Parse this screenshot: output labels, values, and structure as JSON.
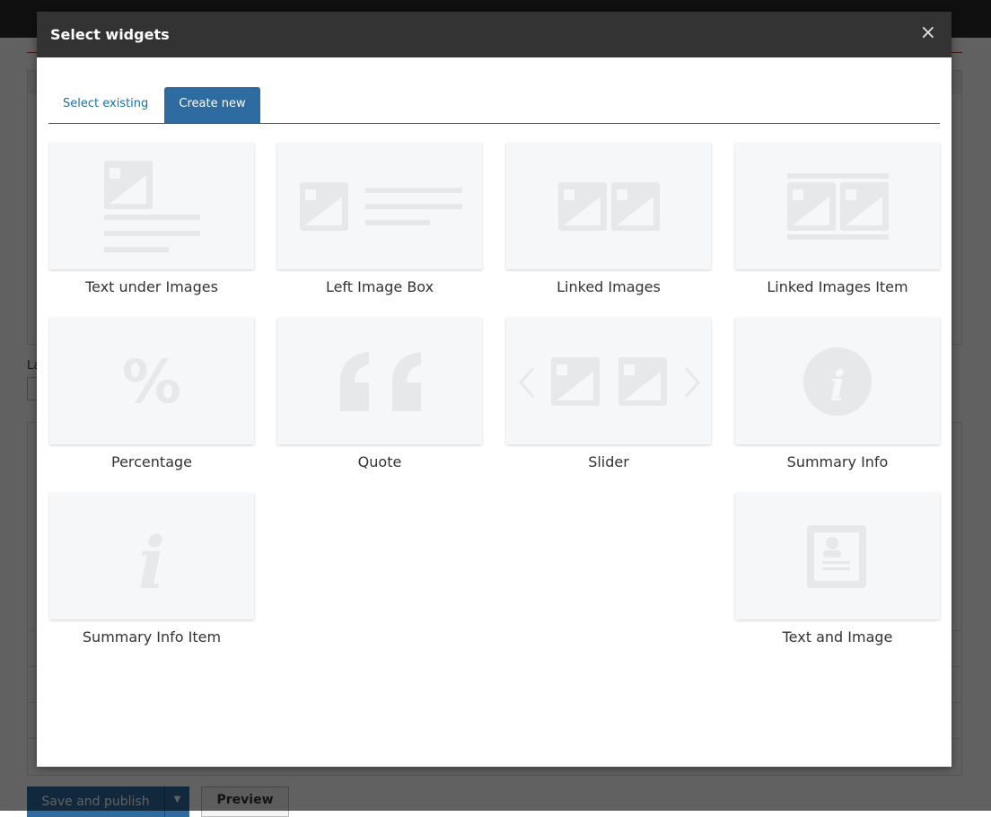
{
  "modal": {
    "title": "Select widgets",
    "close_glyph": "×"
  },
  "tabs": [
    {
      "label": "Select existing",
      "active": false
    },
    {
      "label": "Create new",
      "active": true
    }
  ],
  "widgets": [
    {
      "label": "Text under Images",
      "icon": "text-under-images-icon"
    },
    {
      "label": "Left Image Box",
      "icon": "left-image-box-icon"
    },
    {
      "label": "Linked Images",
      "icon": "linked-images-icon"
    },
    {
      "label": "Linked Images Item",
      "icon": "linked-images-item-icon"
    },
    {
      "label": "Percentage",
      "icon": "percentage-icon"
    },
    {
      "label": "Quote",
      "icon": "quote-icon"
    },
    {
      "label": "Slider",
      "icon": "slider-icon"
    },
    {
      "label": "Summary Info",
      "icon": "summary-info-icon"
    },
    {
      "label": "Summary Info Item",
      "icon": "summary-info-item-icon"
    },
    {
      "label": "Text and Image",
      "icon": "text-and-image-icon"
    }
  ],
  "footer": {
    "save_label": "Save and publish",
    "preview_label": "Preview"
  },
  "colors": {
    "accent": "#2d6ba0",
    "icon_fill": "#e6e8e9",
    "header_bg": "#333333"
  }
}
